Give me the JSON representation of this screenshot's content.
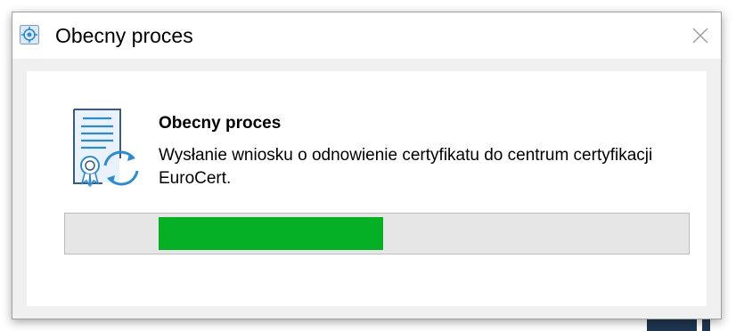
{
  "window": {
    "title": "Obecny proces",
    "app_icon": "app-icon",
    "close_icon": "close-icon"
  },
  "content": {
    "heading": "Obecny proces",
    "description": "Wysłanie wniosku o odnowienie certyfikatu do centrum certyfikacji EuroCert.",
    "icon": "certificate-renew-icon"
  },
  "progress": {
    "mode": "marquee",
    "segment_start_fraction": 0.15,
    "segment_end_fraction": 0.51,
    "fill_color": "#06b025",
    "track_color": "#e6e6e6"
  },
  "colors": {
    "icon_blue": "#2c8ad1",
    "icon_outline": "#3a5a80"
  }
}
